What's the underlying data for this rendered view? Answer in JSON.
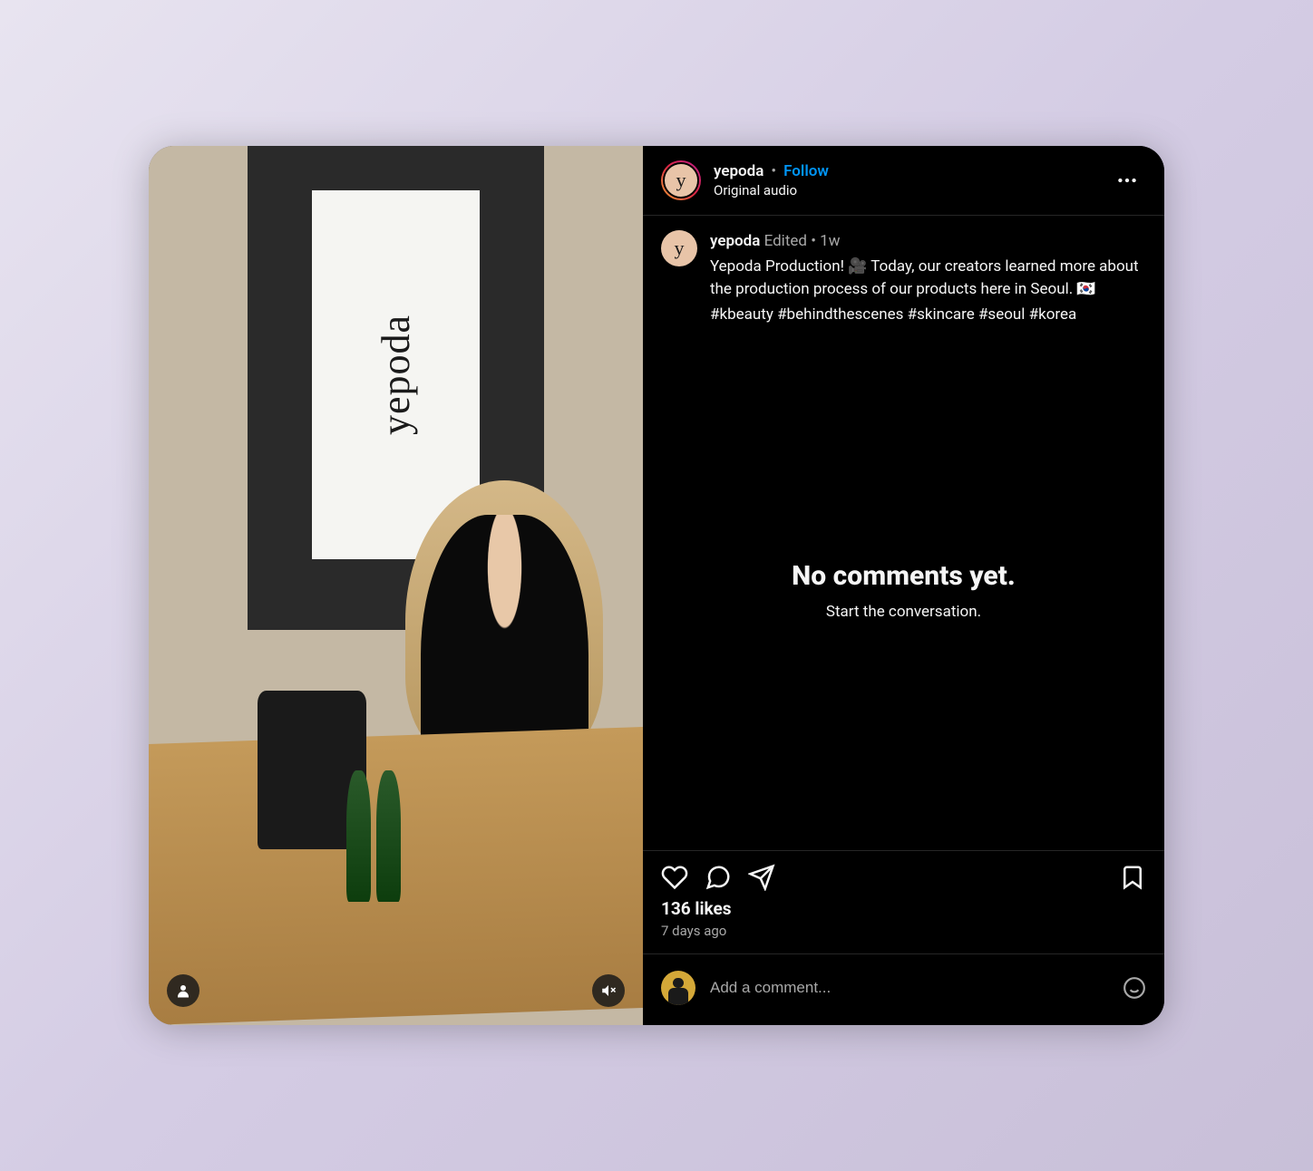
{
  "header": {
    "username": "yepoda",
    "follow_label": "Follow",
    "audio_label": "Original audio",
    "avatar_letter": "y"
  },
  "caption": {
    "username": "yepoda",
    "edited_label": "Edited",
    "age": "1w",
    "body": "Yepoda Production! 🎥 Today, our creators learned more about the production process of our products here in Seoul. 🇰🇷",
    "hashtags": "#kbeauty #behindthescenes #skincare #seoul #korea",
    "avatar_letter": "y"
  },
  "comments": {
    "empty_title": "No comments yet.",
    "empty_subtitle": "Start the conversation."
  },
  "stats": {
    "likes_text": "136 likes",
    "posted_ago": "7 days ago"
  },
  "composer": {
    "placeholder": "Add a comment..."
  },
  "media": {
    "sign_text": "yepoda"
  }
}
